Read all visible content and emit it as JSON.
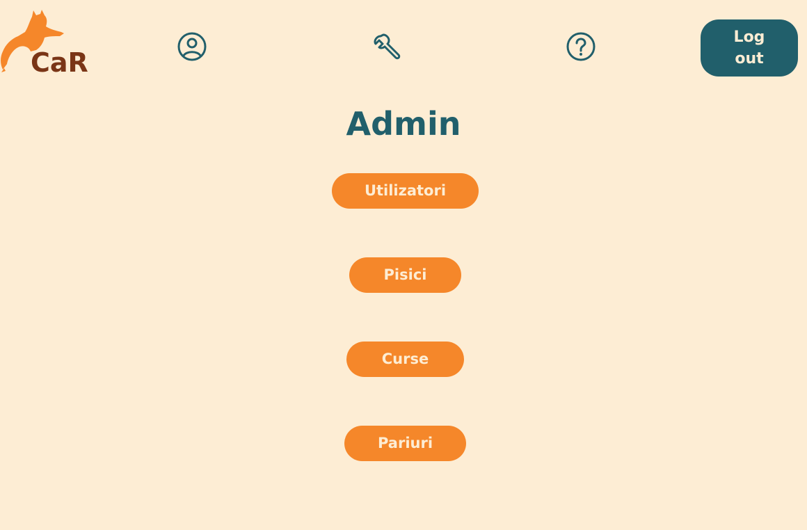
{
  "header": {
    "logo_text": "CaR",
    "nav": [
      {
        "icon": "user-profile-icon"
      },
      {
        "icon": "wrench-icon"
      },
      {
        "icon": "help-icon"
      }
    ],
    "logout_label": "Log out"
  },
  "main": {
    "title": "Admin",
    "buttons": [
      {
        "label": "Utilizatori"
      },
      {
        "label": "Pisici"
      },
      {
        "label": "Curse"
      },
      {
        "label": "Pariuri"
      }
    ]
  },
  "colors": {
    "background": "#fdedd4",
    "primary": "#215f6b",
    "accent": "#f5872a",
    "logo_text": "#7a3516"
  }
}
